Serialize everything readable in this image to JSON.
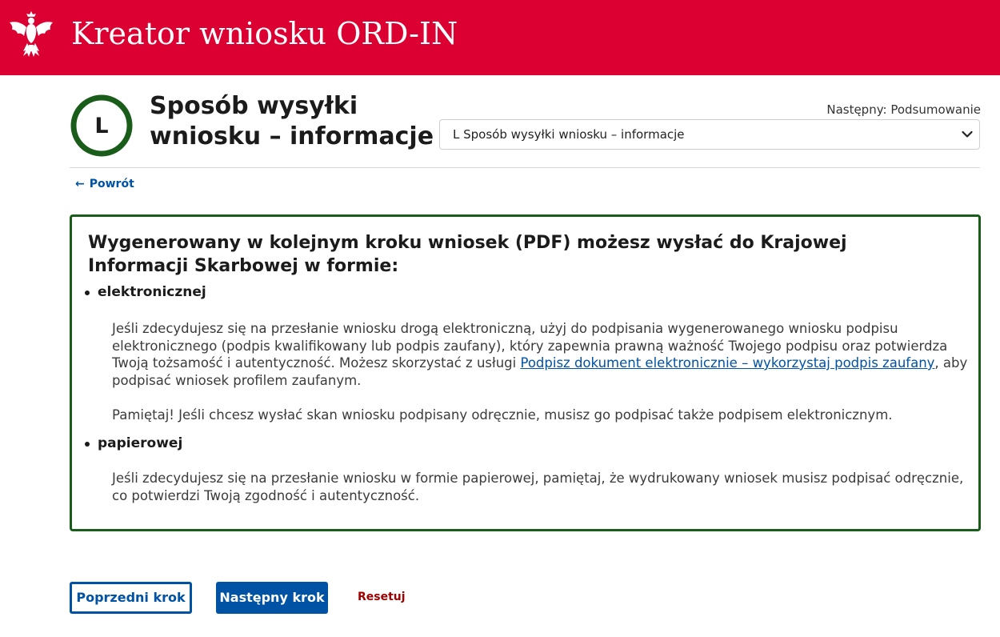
{
  "header": {
    "app_title": "Kreator wniosku ORD-IN",
    "brand_color": "#dc0032",
    "logo_icon": "polish-eagle-emblem"
  },
  "step": {
    "letter": "L",
    "title_line1": "Sposób wysyłki",
    "title_line2": "wniosku – informacje",
    "next_label": "Następny: Podsumowanie",
    "select_value": "L Sposób wysyłki wniosku – informacje",
    "progress_ring_color": "#1a5d1a"
  },
  "nav": {
    "back_label": "Powrót",
    "back_icon": "arrow-left-icon"
  },
  "info": {
    "heading": "Wygenerowany w kolejnym kroku wniosek (PDF) możesz wysłać do Krajowej Informacji Skarbowej w formie:",
    "items": [
      {
        "label": "elektronicznej",
        "paragraph1_before": "Jeśli zdecydujesz się na przesłanie wniosku drogą elektroniczną, użyj do podpisania wygenerowanego wniosku podpisu elektronicznego (podpis kwalifikowany lub podpis zaufany), który zapewnia prawną ważność Twojego podpisu oraz potwierdza Twoją tożsamość i autentyczność. Możesz skorzystać z usługi ",
        "link_text": "Podpisz dokument elektronicznie – wykorzystaj podpis zaufany",
        "paragraph1_after": ", aby podpisać wniosek profilem zaufanym.",
        "paragraph2": "Pamiętaj! Jeśli chcesz wysłać skan wniosku podpisany odręcznie, musisz go podpisać także podpisem elektronicznym."
      },
      {
        "label": "papierowej",
        "paragraph1": "Jeśli zdecydujesz się na przesłanie wniosku w formie papierowej, pamiętaj, że wydrukowany wniosek musisz podpisać odręcznie, co potwierdzi Twoją zgodność i autentyczność."
      }
    ],
    "border_color": "#1a5d1a"
  },
  "actions": {
    "prev_label": "Poprzedni krok",
    "next_label": "Następny krok",
    "reset_label": "Resetuj",
    "primary_color": "#0052a5",
    "reset_color": "#a00000"
  }
}
